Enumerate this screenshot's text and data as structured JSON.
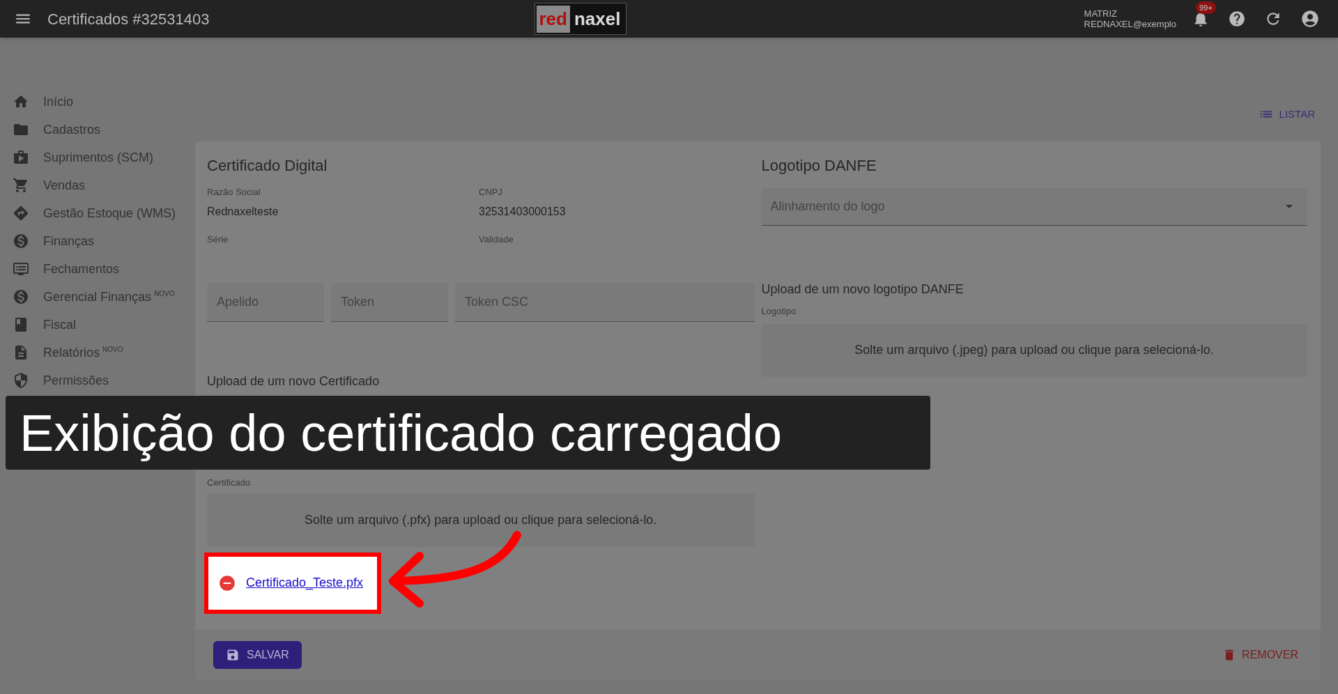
{
  "app_bar": {
    "title": "Certificados #32531403",
    "logo": [
      "red",
      "naxel"
    ],
    "company": "MATRIZ",
    "user": "REDNAXEL@exemplo",
    "notification_badge": "99+"
  },
  "sidebar": {
    "items": [
      {
        "label": "Início"
      },
      {
        "label": "Cadastros"
      },
      {
        "label": "Suprimentos (SCM)"
      },
      {
        "label": "Vendas"
      },
      {
        "label": "Gestão Estoque (WMS)"
      },
      {
        "label": "Finanças"
      },
      {
        "label": "Fechamentos"
      },
      {
        "label": "Gerencial Finanças",
        "badge": "NOVO"
      },
      {
        "label": "Fiscal"
      },
      {
        "label": "Relatórios",
        "badge": "NOVO"
      },
      {
        "label": "Permissões"
      }
    ]
  },
  "toolbar": {
    "list_button": "LISTAR"
  },
  "certificate": {
    "title": "Certificado Digital",
    "fields": [
      {
        "label": "Razão Social",
        "value": "Rednaxelteste"
      },
      {
        "label": "CNPJ",
        "value": "32531403000153"
      },
      {
        "label": "Série"
      },
      {
        "label": "Validade"
      }
    ],
    "inputs": [
      {
        "placeholder": "Apelido"
      },
      {
        "placeholder": "Token"
      },
      {
        "placeholder": "Token CSC"
      }
    ],
    "upload_heading": "Upload de um novo Certificado",
    "file_label": "Certificado",
    "dropzone": "Solte um arquivo (.pfx) para upload ou clique para selecioná-lo.",
    "uploaded_file": "Certificado_Teste.pfx"
  },
  "logo_danfe": {
    "title": "Logotipo DANFE",
    "select": {
      "placeholder": "Alinhamento do logo"
    },
    "upload_heading": "Upload de um novo logotipo DANFE",
    "file_label": "Logotipo",
    "dropzone": "Solte um arquivo (.jpeg) para upload ou clique para selecioná-lo."
  },
  "footer": {
    "save": "SALVAR",
    "remove": "REMOVER"
  },
  "caption": "Exibição do certificado carregado"
}
